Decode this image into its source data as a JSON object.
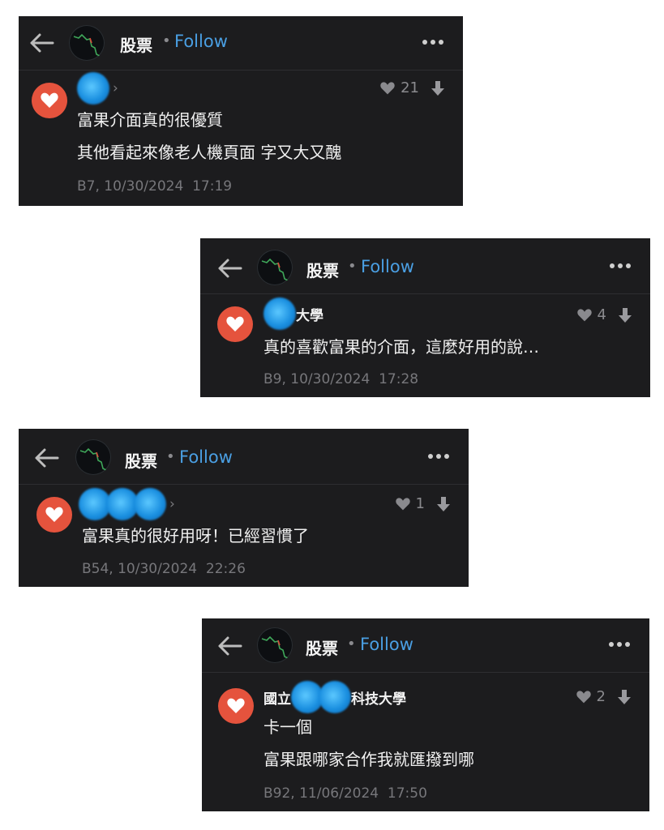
{
  "header": {
    "forum_name": "股票",
    "separator": "•",
    "follow_label": "Follow"
  },
  "colors": {
    "card_bg": "#1c1c1e",
    "accent_link": "#4a9fe3",
    "like_badge": "#e5533d",
    "muted": "#8a8a8e"
  },
  "icons": [
    "back-arrow-icon",
    "forum-avatar-chart",
    "more-dots-icon",
    "heart-icon",
    "down-arrow-icon",
    "chevron-right-icon"
  ],
  "comments": [
    {
      "author_suffix": "",
      "author_prefix": "",
      "show_chevron": true,
      "likes": "21",
      "lines": [
        "富果介面真的很優質",
        "其他看起來像老人機頁面 字又大又醜"
      ],
      "floor": "B7",
      "date": "10/30/2024",
      "time": "17:19"
    },
    {
      "author_prefix": "",
      "author_suffix": "大學",
      "show_chevron": false,
      "likes": "4",
      "lines": [
        "真的喜歡富果的介面，這麼好用的說…"
      ],
      "floor": "B9",
      "date": "10/30/2024",
      "time": "17:28"
    },
    {
      "author_prefix": "",
      "author_suffix": "",
      "show_chevron": true,
      "likes": "1",
      "lines": [
        "富果真的很好用呀！已經習慣了"
      ],
      "floor": "B54",
      "date": "10/30/2024",
      "time": "22:26"
    },
    {
      "author_prefix": "國立",
      "author_suffix": "科技大學",
      "show_chevron": false,
      "likes": "2",
      "lines": [
        "卡一個",
        "富果跟哪家合作我就匯撥到哪"
      ],
      "floor": "B92",
      "date": "11/06/2024",
      "time": "17:50"
    }
  ]
}
